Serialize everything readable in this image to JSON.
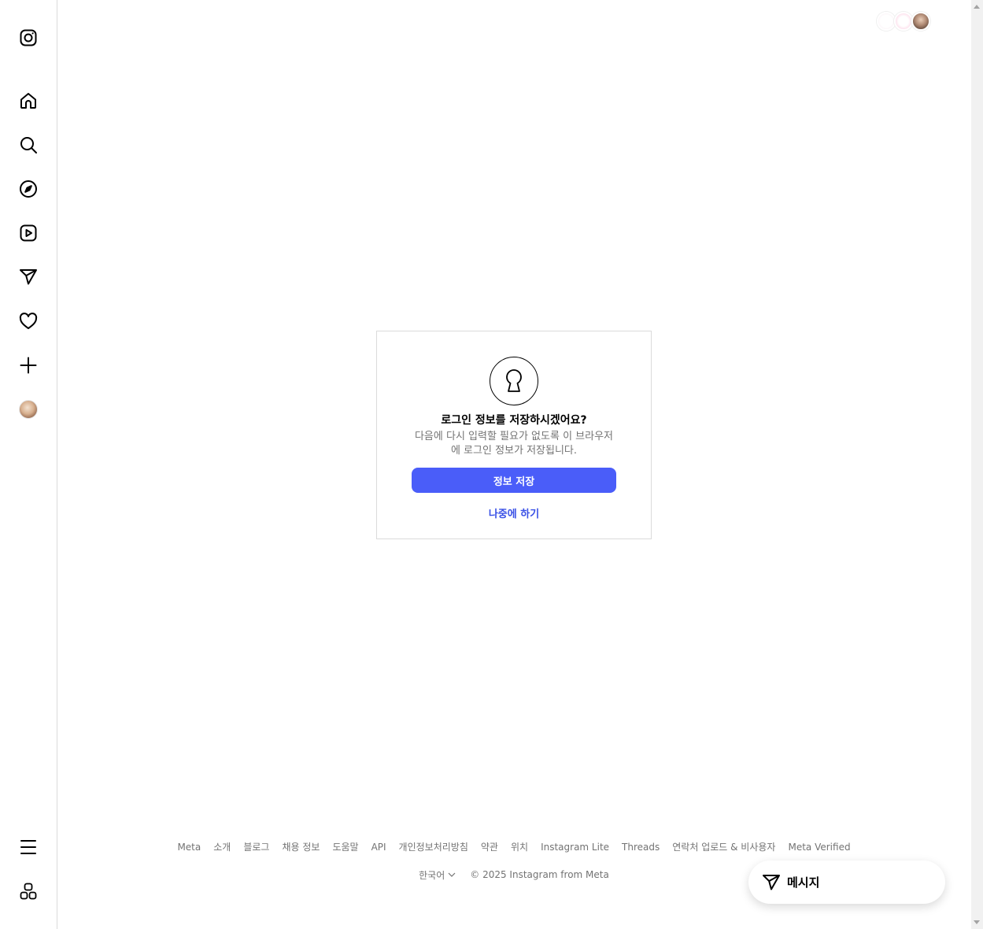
{
  "sidebar": {
    "items": [
      {
        "name": "instagram-logo-icon"
      },
      {
        "name": "home-icon"
      },
      {
        "name": "search-icon"
      },
      {
        "name": "explore-compass-icon"
      },
      {
        "name": "reels-icon"
      },
      {
        "name": "messages-send-icon"
      },
      {
        "name": "notifications-heart-icon"
      },
      {
        "name": "create-plus-icon"
      },
      {
        "name": "profile-avatar"
      }
    ],
    "bottom": [
      {
        "name": "more-menu-icon"
      },
      {
        "name": "also-from-meta-icon"
      }
    ]
  },
  "dialog": {
    "icon": "keyhole-lock-icon",
    "title": "로그인 정보를 저장하시겠어요?",
    "description": "다음에 다시 입력할 필요가 없도록 이 브라우저에 로그인 정보가 저장됩니다.",
    "save_label": "정보 저장",
    "later_label": "나중에 하기"
  },
  "footer": {
    "links": [
      "Meta",
      "소개",
      "블로그",
      "채용 정보",
      "도움말",
      "API",
      "개인정보처리방침",
      "약관",
      "위치",
      "Instagram Lite",
      "Threads",
      "연락처 업로드 & 비사용자",
      "Meta Verified"
    ],
    "language": "한국어",
    "copyright": "© 2025 Instagram from Meta"
  },
  "messages_pill": {
    "label": "메시지",
    "icon": "send-icon"
  },
  "colors": {
    "primary_button": "#4a5df9",
    "link": "#3950e6",
    "muted_text": "#737373",
    "border": "#dbdbdb"
  }
}
